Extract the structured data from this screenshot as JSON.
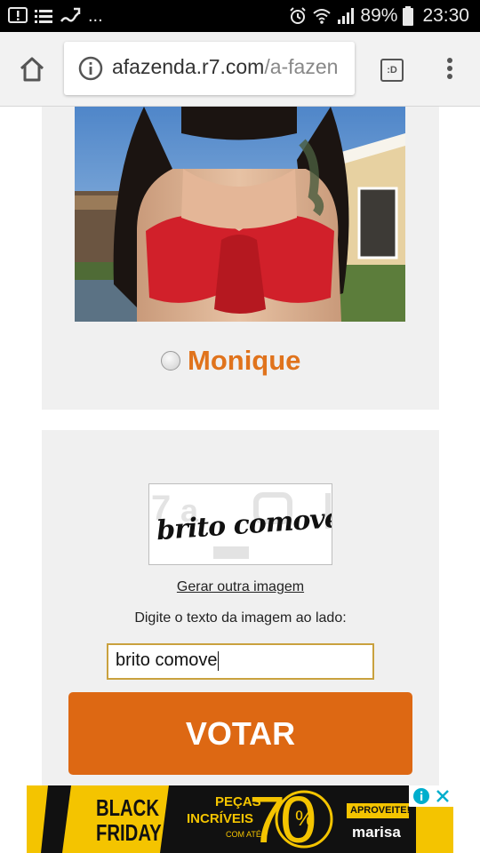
{
  "status_bar": {
    "icons_left": [
      "alert-icon",
      "list-icon",
      "wave-icon"
    ],
    "more": "...",
    "icons_right": [
      "alarm-icon",
      "wifi-icon",
      "signal-icon",
      "battery-icon"
    ],
    "battery": "89%",
    "time": "23:30"
  },
  "browser": {
    "url_domain": "afazenda.r7.com",
    "url_path": "/a-fazen",
    "tabs_label": ":D"
  },
  "vote_card": {
    "candidate": "Monique",
    "selected": false
  },
  "captcha_card": {
    "captcha_text": "brito comove",
    "regenerate_label": "Gerar outra imagem",
    "hint": "Digite o texto da imagem ao lado:",
    "input_value": "brito comove",
    "vote_label": "VOTAR"
  },
  "ad": {
    "black": "BLACK",
    "friday": "FRIDAY",
    "pecas": "PEÇAS",
    "incriveis": "INCRÍVEIS",
    "com_ate": "COM ATÉ",
    "number": "70",
    "percent": "%",
    "aproveite": "APROVEITE!",
    "brand": "marisa",
    "colors": {
      "yellow": "#f4c400",
      "dark": "#111111"
    }
  },
  "colors": {
    "accent": "#dd6813",
    "name": "#e0731c",
    "card_bg": "#f0f0f0"
  }
}
